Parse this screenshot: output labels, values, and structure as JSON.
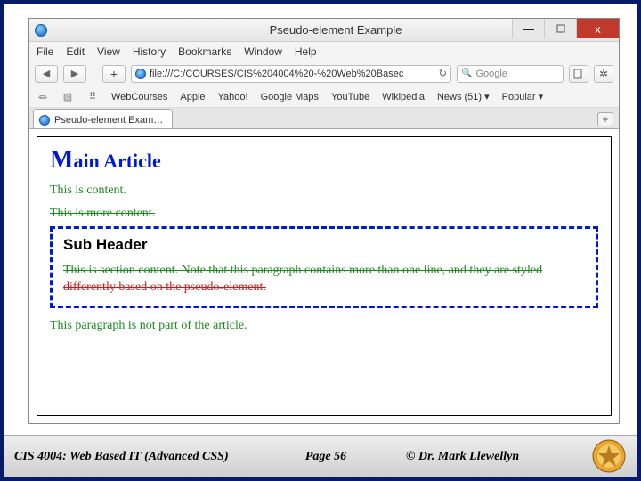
{
  "window": {
    "title": "Pseudo-element Example",
    "min": "—",
    "max": "",
    "close": "x"
  },
  "menu": {
    "file": "File",
    "edit": "Edit",
    "view": "View",
    "history": "History",
    "bookmarks": "Bookmarks",
    "window": "Window",
    "help": "Help"
  },
  "nav": {
    "url": "file:///C:/COURSES/CIS%204004%20-%20Web%20Basec",
    "reload_icon": "↻",
    "search_placeholder": "Google",
    "search_icon": "🔍"
  },
  "bookmarks": {
    "panel_icon": "⏛",
    "reader_icon": "▧",
    "grid_icon": "⠿",
    "items": [
      "WebCourses",
      "Apple",
      "Yahoo!",
      "Google Maps",
      "YouTube",
      "Wikipedia",
      "News (51) ▾",
      "Popular ▾"
    ]
  },
  "tab": {
    "label": "Pseudo-element Exam…",
    "new": "+"
  },
  "page": {
    "h1_first": "M",
    "h1_rest": "ain Article",
    "p1": "This is content.",
    "p2": "This is more content.",
    "sub_h": "Sub Header",
    "sec_line1": "This is section content. Note that this paragraph contains more than one line, and they are styled",
    "sec_line2": "differently based on the pseudo-element.",
    "outside": "This paragraph is not part of the article."
  },
  "footer": {
    "left": "CIS 4004: Web Based IT (Advanced CSS)",
    "center": "Page 56",
    "right": "© Dr. Mark Llewellyn"
  }
}
